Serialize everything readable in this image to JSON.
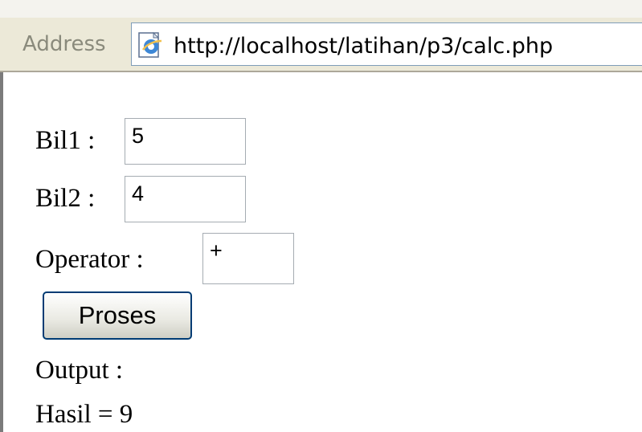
{
  "browser": {
    "address_label": "Address",
    "url": "http://localhost/latihan/p3/calc.php"
  },
  "form": {
    "bil1_label": "Bil1 :",
    "bil1_value": "5",
    "bil2_label": "Bil2 :",
    "bil2_value": "4",
    "operator_label": "Operator :",
    "operator_value": "+",
    "submit_label": "Proses",
    "output_label": "Output :",
    "result_text": "Hasil = 9"
  }
}
